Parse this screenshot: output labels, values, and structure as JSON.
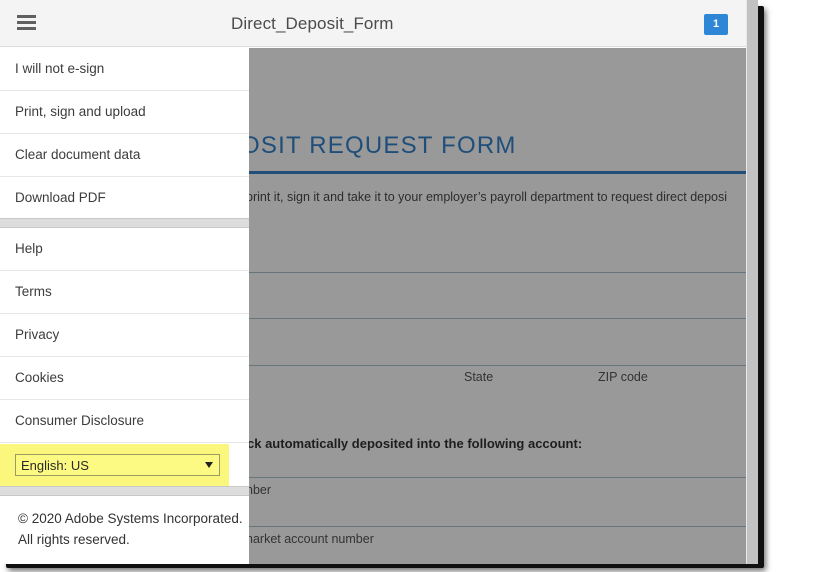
{
  "header": {
    "menu_icon": "hamburger-menu-icon",
    "title": "Direct_Deposit_Form",
    "page_badge": "1",
    "badge_color": "#2d87d6"
  },
  "sidebar": {
    "group_1": [
      {
        "label": "I will not e-sign"
      },
      {
        "label": "Print, sign and upload"
      },
      {
        "label": "Clear document data"
      },
      {
        "label": "Download PDF"
      }
    ],
    "group_2": [
      {
        "label": "Help"
      },
      {
        "label": "Terms"
      },
      {
        "label": "Privacy"
      },
      {
        "label": "Cookies"
      },
      {
        "label": "Consumer Disclosure"
      }
    ],
    "language_select": {
      "value": "English: US",
      "highlight_color": "#fbf67c"
    },
    "copyright_line1": "© 2020 Adobe Systems Incorporated.",
    "copyright_line2": "All rights reserved."
  },
  "document": {
    "heading": "OSIT REQUEST FORM",
    "intro": "print it, sign it and take it to your employer’s payroll department to request direct deposi",
    "labels": {
      "state": "State",
      "zip": "ZIP code",
      "account_instruction": "ck automatically deposited into the following account:",
      "account_number": "nber",
      "money_market": "narket account number"
    },
    "heading_color": "#1f4e7a"
  }
}
